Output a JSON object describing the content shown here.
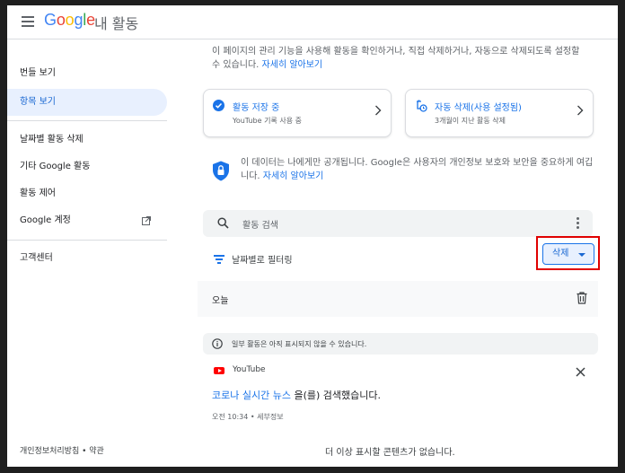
{
  "header": {
    "logo_letters": [
      "G",
      "o",
      "o",
      "g",
      "l",
      "e"
    ],
    "title": "내 활동"
  },
  "sidebar": {
    "items": [
      {
        "label": "번들 보기"
      },
      {
        "label": "항목 보기",
        "active": true
      },
      {
        "label": "날짜별 활동 삭제"
      },
      {
        "label": "기타 Google 활동"
      },
      {
        "label": "활동 제어"
      },
      {
        "label": "Google 계정"
      },
      {
        "label": "고객센터"
      }
    ],
    "footer": "개인정보처리방침 • 약관"
  },
  "main": {
    "intro_text": "이 페이지의 관리 기능을 사용해 활동을 확인하거나, 직접 삭제하거나, 자동으로 삭제되도록 설정할 수 있습니다.",
    "intro_link": "자세히 알아보기",
    "cards": [
      {
        "title": "활동 저장 중",
        "subtitle": "YouTube 기록 사용 중"
      },
      {
        "title": "자동 삭제(사용 설정됨)",
        "subtitle": "3개월이 지난 활동 삭제"
      }
    ],
    "privacy_text": "이 데이터는 나에게만 공개됩니다. Google은 사용자의 개인정보 보호와 보안을 중요하게 여깁니다.",
    "privacy_link": "자세히 알아보기",
    "search_placeholder": "활동 검색",
    "filter_label": "날짜별로 필터링",
    "delete_label": "삭제",
    "today_label": "오늘",
    "notice_text": "일부 활동은 아직 표시되지 않을 수 있습니다.",
    "source": "YouTube",
    "activity_query": "코로나 실시간 뉴스",
    "activity_suffix": " 을(를) 검색했습니다.",
    "activity_meta": "오전 10:34 • 세부정보",
    "end_message": "더 이상 표시할 콘텐츠가 없습니다."
  },
  "colors": {
    "accent": "#1a73e8",
    "active_nav_bg": "#e8f0fe",
    "highlight_box": "#e00000",
    "youtube_red": "#ff0000"
  }
}
